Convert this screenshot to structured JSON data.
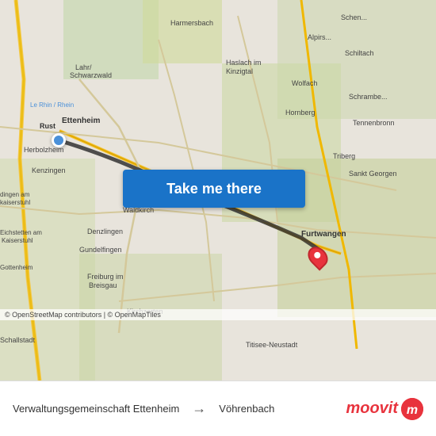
{
  "map": {
    "background_color": "#e8e0d5",
    "attribution": "© OpenStreetMap contributors | © OpenMapTiles"
  },
  "button": {
    "label": "Take me there"
  },
  "bottom_bar": {
    "origin": "Verwaltungsgemeinschaft Ettenheim",
    "destination": "Vöhrenbach",
    "arrow": "→",
    "logo_text": "moovit"
  },
  "icons": {
    "origin_dot": "●",
    "arrow": "→",
    "moovit_m": "m"
  }
}
